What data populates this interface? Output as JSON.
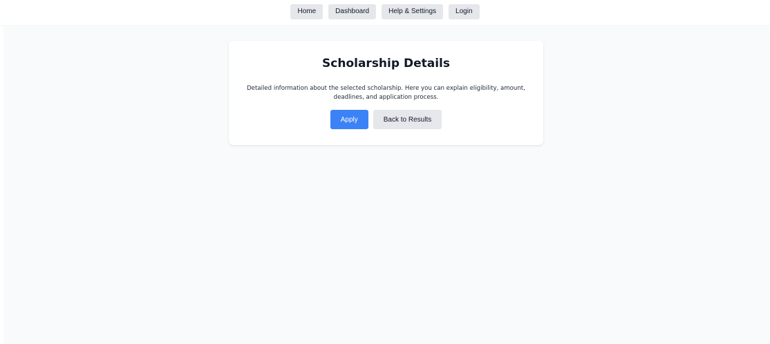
{
  "nav": {
    "items": [
      {
        "label": "Home"
      },
      {
        "label": "Dashboard"
      },
      {
        "label": "Help & Settings"
      },
      {
        "label": "Login"
      }
    ]
  },
  "card": {
    "title": "Scholarship Details",
    "description": "Detailed information about the selected scholarship. Here you can explain eligibility, amount, deadlines, and application process.",
    "apply_label": "Apply",
    "back_label": "Back to Results"
  },
  "colors": {
    "primary": "#3b82f6",
    "secondary": "#e5e7eb",
    "background": "#f9fafb"
  }
}
